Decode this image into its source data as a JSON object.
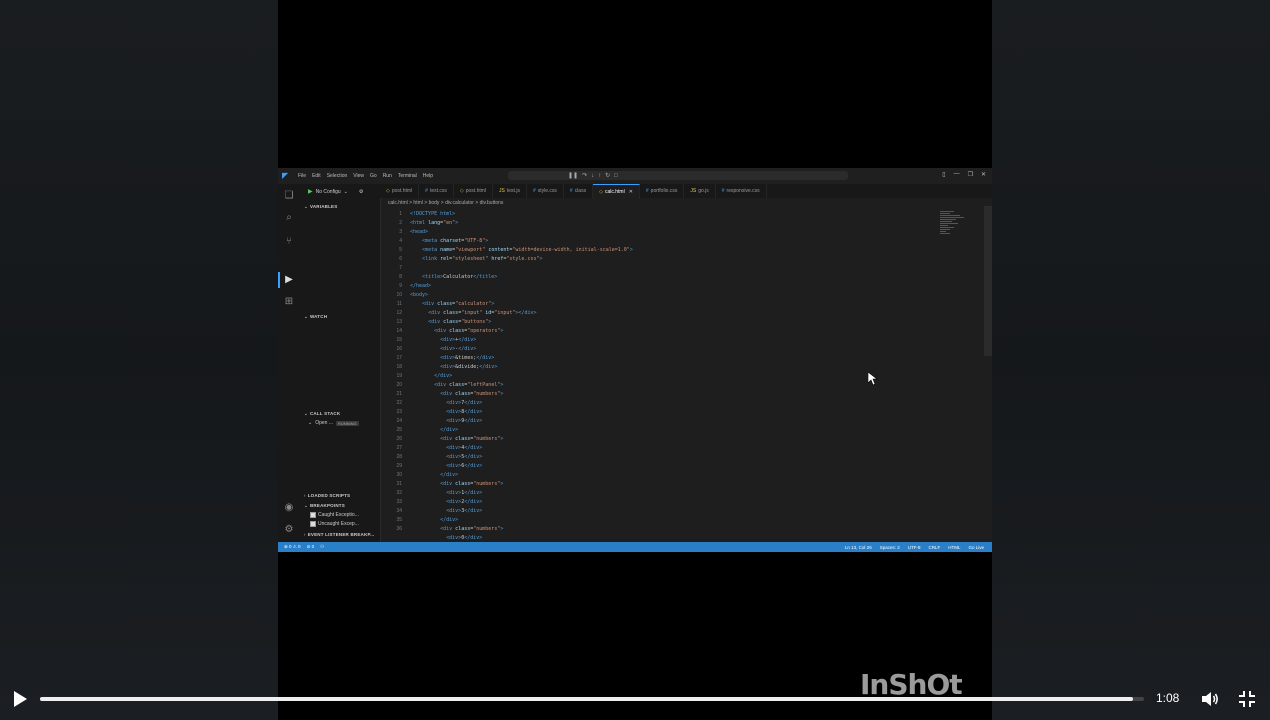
{
  "player": {
    "time": "1:08",
    "progress_fraction": 0.99,
    "watermark": "InShOt"
  },
  "vscode": {
    "menu": [
      "File",
      "Edit",
      "Selection",
      "View",
      "Go",
      "Run",
      "Terminal",
      "Help"
    ],
    "run_config": "No Configu",
    "tabs": [
      {
        "label": "post.html",
        "kind": "html",
        "active": false
      },
      {
        "label": "test.css",
        "kind": "css",
        "active": false
      },
      {
        "label": "post.html",
        "kind": "html",
        "active": false
      },
      {
        "label": "test.js",
        "kind": "js",
        "active": false
      },
      {
        "label": "style.css",
        "kind": "css",
        "active": false
      },
      {
        "label": "class",
        "kind": "css",
        "active": false
      },
      {
        "label": "calc.html",
        "kind": "html",
        "active": true
      },
      {
        "label": "portfolio.css",
        "kind": "css",
        "active": false
      },
      {
        "label": "go.js",
        "kind": "js",
        "active": false
      },
      {
        "label": "responsive.css",
        "kind": "css",
        "active": false
      }
    ],
    "breadcrumb": "calc.html > html > body > div.calculator > div.buttons",
    "sidebar": {
      "variables": "VARIABLES",
      "watch": "WATCH",
      "call_stack": "CALL STACK",
      "call_stack_item": "Open ...",
      "call_stack_badge": "RUNNING",
      "loaded_scripts": "LOADED SCRIPTS",
      "breakpoints": "BREAKPOINTS",
      "bp_items": [
        "Caught Exceptio...",
        "Uncaught Excep..."
      ],
      "event_listener": "EVENT LISTENER BREAKP..."
    },
    "line_numbers": [
      "1",
      "2",
      "3",
      "4",
      "5",
      "6",
      "7",
      "8",
      "9",
      "10",
      "11",
      "12",
      "13",
      "14",
      "15",
      "16",
      "17",
      "18",
      "19",
      "20",
      "21",
      "22",
      "23",
      "24",
      "25",
      "26",
      "27",
      "28",
      "29",
      "30",
      "31",
      "32",
      "33",
      "34",
      "35",
      "36"
    ],
    "status": {
      "left": [
        "⊗ 0 ⚠ 0",
        "⊘ 0",
        "⚇"
      ],
      "right": [
        "Ln 13, Col 26",
        "Spaces: 2",
        "UTF-8",
        "CRLF",
        "HTML",
        "Go Live"
      ]
    }
  }
}
